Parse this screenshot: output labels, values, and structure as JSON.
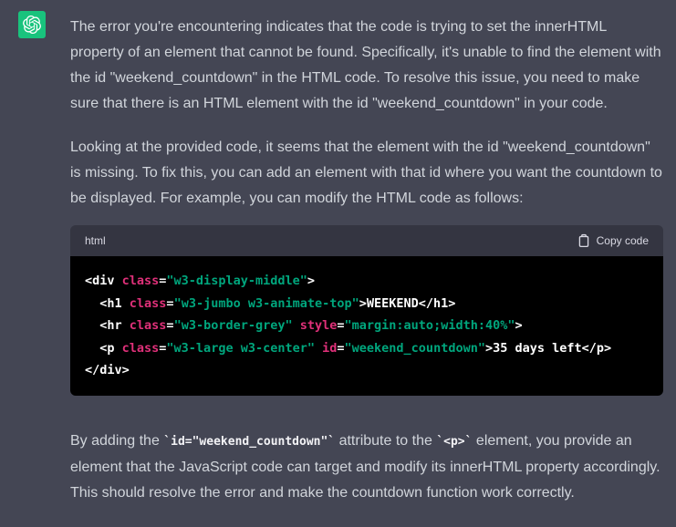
{
  "colors": {
    "page_bg": "#444654",
    "text": "#d1d5db",
    "code_header_bg": "#343541",
    "code_bg": "#000000",
    "code_plain": "#ffffff",
    "code_attr_pink": "#df3079",
    "code_string_green": "#00a67d",
    "avatar_green": "#19c37d"
  },
  "message": {
    "avatar_icon": "openai-logo-icon",
    "paragraphs": [
      "The error you're encountering indicates that the code is trying to set the innerHTML property of an element that cannot be found. Specifically, it's unable to find the element with the id \"weekend_countdown\" in the HTML code. To resolve this issue, you need to make sure that there is an HTML element with the id \"weekend_countdown\" in your code.",
      "Looking at the provided code, it seems that the element with the id \"weekend_countdown\" is missing. To fix this, you can add an element with that id where you want the countdown to be displayed. For example, you can modify the HTML code as follows:"
    ],
    "code_block": {
      "language": "html",
      "copy_label": "Copy code",
      "copy_icon": "clipboard-icon",
      "lines": [
        [
          {
            "c": "plain",
            "t": "<div "
          },
          {
            "c": "attr",
            "t": "class"
          },
          {
            "c": "plain",
            "t": "="
          },
          {
            "c": "string",
            "t": "\"w3-display-middle\""
          },
          {
            "c": "plain",
            "t": ">"
          }
        ],
        [
          {
            "c": "plain",
            "t": "  <h1 "
          },
          {
            "c": "attr",
            "t": "class"
          },
          {
            "c": "plain",
            "t": "="
          },
          {
            "c": "string",
            "t": "\"w3-jumbo w3-animate-top\""
          },
          {
            "c": "plain",
            "t": ">WEEKEND</h1>"
          }
        ],
        [
          {
            "c": "plain",
            "t": "  <hr "
          },
          {
            "c": "attr",
            "t": "class"
          },
          {
            "c": "plain",
            "t": "="
          },
          {
            "c": "string",
            "t": "\"w3-border-grey\""
          },
          {
            "c": "plain",
            "t": " "
          },
          {
            "c": "attr",
            "t": "style"
          },
          {
            "c": "plain",
            "t": "="
          },
          {
            "c": "string",
            "t": "\"margin:auto;width:40%\""
          },
          {
            "c": "plain",
            "t": ">"
          }
        ],
        [
          {
            "c": "plain",
            "t": "  <p "
          },
          {
            "c": "attr",
            "t": "class"
          },
          {
            "c": "plain",
            "t": "="
          },
          {
            "c": "string",
            "t": "\"w3-large w3-center\""
          },
          {
            "c": "plain",
            "t": " "
          },
          {
            "c": "attr",
            "t": "id"
          },
          {
            "c": "plain",
            "t": "="
          },
          {
            "c": "string",
            "t": "\"weekend_countdown\""
          },
          {
            "c": "plain",
            "t": ">35 days left</p>"
          }
        ],
        [
          {
            "c": "plain",
            "t": "</div>"
          }
        ]
      ]
    },
    "closing_paragraph": [
      {
        "type": "text",
        "value": "By adding the "
      },
      {
        "type": "code",
        "value": "`id=\"weekend_countdown\"`"
      },
      {
        "type": "text",
        "value": " attribute to the "
      },
      {
        "type": "code",
        "value": "`<p>`"
      },
      {
        "type": "text",
        "value": " element, you provide an element that the JavaScript code can target and modify its innerHTML property accordingly. This should resolve the error and make the countdown function work correctly."
      }
    ]
  }
}
